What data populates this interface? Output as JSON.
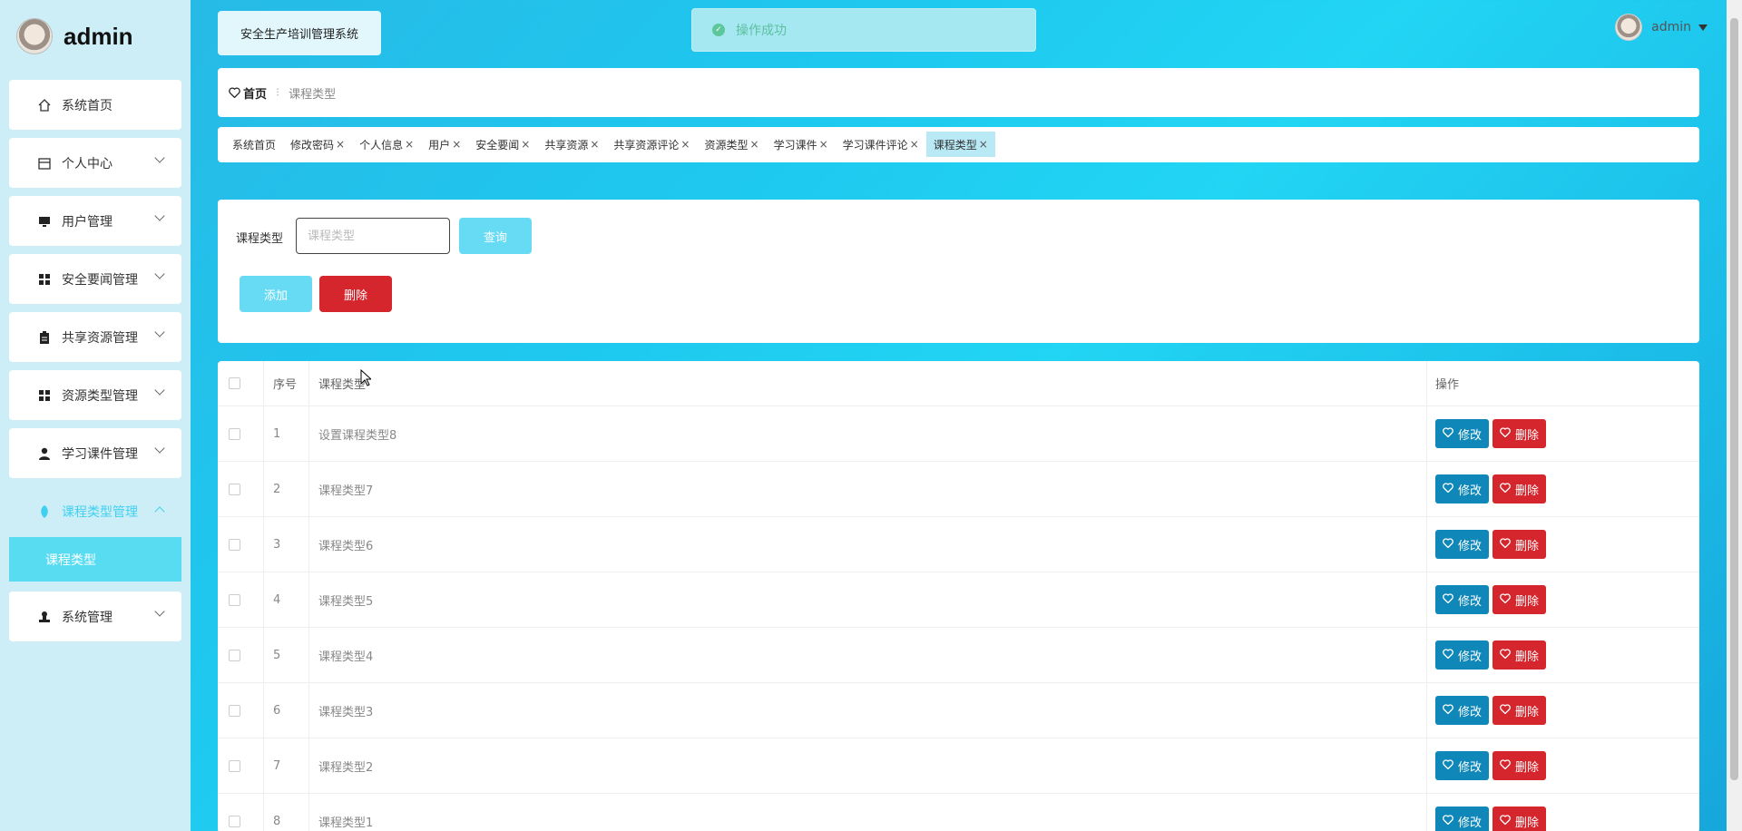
{
  "brand": {
    "name": "admin"
  },
  "sidebar": {
    "items": [
      {
        "label": "系统首页",
        "icon": "home-icon",
        "expandable": false
      },
      {
        "label": "个人中心",
        "icon": "calendar-icon",
        "expandable": true
      },
      {
        "label": "用户管理",
        "icon": "monitor-icon",
        "expandable": true
      },
      {
        "label": "安全要闻管理",
        "icon": "grid-icon",
        "expandable": true
      },
      {
        "label": "共享资源管理",
        "icon": "clipboard-icon",
        "expandable": true
      },
      {
        "label": "资源类型管理",
        "icon": "grid-icon",
        "expandable": true
      },
      {
        "label": "学习课件管理",
        "icon": "user-icon",
        "expandable": true
      },
      {
        "label": "课程类型管理",
        "icon": "leaf-icon",
        "expandable": true,
        "active": true
      },
      {
        "label": "系统管理",
        "icon": "stamp-icon",
        "expandable": true
      }
    ],
    "submenu": {
      "label": "课程类型"
    }
  },
  "header": {
    "system_title": "安全生产培训管理系统",
    "toast": "操作成功",
    "user": "admin"
  },
  "breadcrumb": {
    "home": "首页",
    "current": "课程类型"
  },
  "tags": [
    {
      "label": "系统首页",
      "closable": false
    },
    {
      "label": "修改密码",
      "closable": true
    },
    {
      "label": "个人信息",
      "closable": true
    },
    {
      "label": "用户",
      "closable": true
    },
    {
      "label": "安全要闻",
      "closable": true
    },
    {
      "label": "共享资源",
      "closable": true
    },
    {
      "label": "共享资源评论",
      "closable": true
    },
    {
      "label": "资源类型",
      "closable": true
    },
    {
      "label": "学习课件",
      "closable": true
    },
    {
      "label": "学习课件评论",
      "closable": true
    },
    {
      "label": "课程类型",
      "closable": true,
      "active": true
    }
  ],
  "search": {
    "label": "课程类型",
    "placeholder": "课程类型",
    "query_label": "查询",
    "add_label": "添加",
    "delete_label": "删除"
  },
  "table": {
    "headers": {
      "index": "序号",
      "name": "课程类型",
      "operation": "操作"
    },
    "edit_label": "修改",
    "delete_label": "删除",
    "rows": [
      {
        "index": "1",
        "name": "设置课程类型8"
      },
      {
        "index": "2",
        "name": "课程类型7"
      },
      {
        "index": "3",
        "name": "课程类型6"
      },
      {
        "index": "4",
        "name": "课程类型5"
      },
      {
        "index": "5",
        "name": "课程类型4"
      },
      {
        "index": "6",
        "name": "课程类型3"
      },
      {
        "index": "7",
        "name": "课程类型2"
      },
      {
        "index": "8",
        "name": "课程类型1"
      }
    ]
  },
  "colors": {
    "accent": "#3fd0ef",
    "edit": "#0f87b8",
    "danger": "#d5262e",
    "toast_bg": "#a6e8f1"
  }
}
